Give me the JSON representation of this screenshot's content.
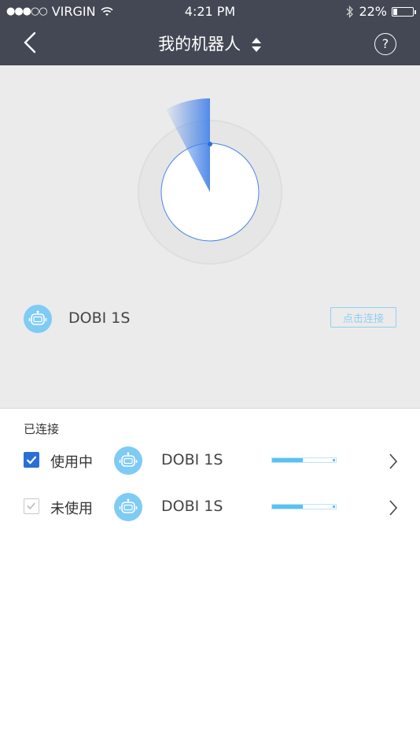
{
  "status_bar": {
    "carrier": "VIRGIN",
    "signal_dots": "●●●○○",
    "time": "4:21 PM",
    "battery_text": "22%",
    "battery_level": 0.22
  },
  "nav": {
    "title": "我的机器人"
  },
  "scan": {
    "found_device": {
      "name": "DOBI 1S",
      "connect_label": "点击连接"
    }
  },
  "connected": {
    "label": "已连接",
    "devices": [
      {
        "status": "使用中",
        "name": "DOBI 1S",
        "checked": true,
        "level": 0.48
      },
      {
        "status": "未使用",
        "name": "DOBI 1S",
        "checked": false,
        "level": 0.48
      }
    ]
  },
  "colors": {
    "nav_bg": "#434854",
    "scan_bg": "#ebebeb",
    "accent_blue": "#2b6fd6",
    "robot_icon_bg": "#7ecbf5",
    "bar_fill": "#58c2f3"
  }
}
